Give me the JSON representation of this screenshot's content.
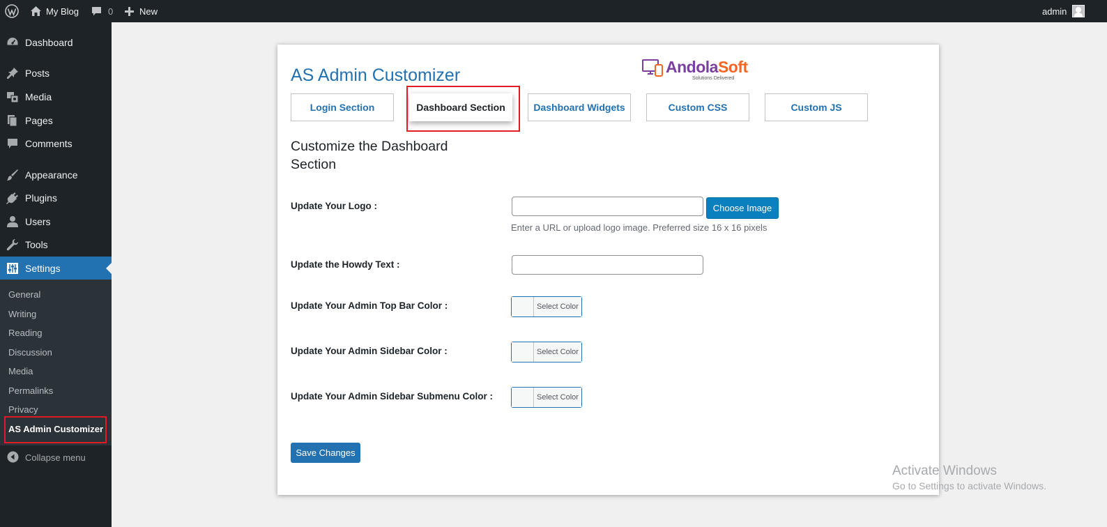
{
  "admin_bar": {
    "site_name": "My Blog",
    "comments_count": "0",
    "new_label": "New",
    "user_name": "admin",
    "icons": [
      "wordpress-icon",
      "home-icon",
      "comment-icon",
      "plus-icon"
    ]
  },
  "sidebar": {
    "items": [
      {
        "label": "Dashboard",
        "icon": "dashboard-icon"
      },
      {
        "label": "Posts",
        "icon": "pin-icon"
      },
      {
        "label": "Media",
        "icon": "media-icon"
      },
      {
        "label": "Pages",
        "icon": "pages-icon"
      },
      {
        "label": "Comments",
        "icon": "comment-icon"
      },
      {
        "label": "Appearance",
        "icon": "brush-icon"
      },
      {
        "label": "Plugins",
        "icon": "plug-icon"
      },
      {
        "label": "Users",
        "icon": "user-icon"
      },
      {
        "label": "Tools",
        "icon": "wrench-icon"
      },
      {
        "label": "Settings",
        "icon": "settings-icon"
      }
    ],
    "submenu": [
      "General",
      "Writing",
      "Reading",
      "Discussion",
      "Media",
      "Permalinks",
      "Privacy",
      "AS Admin Customizer"
    ],
    "collapse_label": "Collapse menu"
  },
  "main": {
    "title": "AS Admin Customizer",
    "logo": {
      "brand_a": "Andola",
      "brand_b": "Soft",
      "tagline": "Solutions Delivered"
    },
    "tabs": [
      "Login Section",
      "Dashboard Section",
      "Dashboard Widgets",
      "Custom CSS",
      "Custom JS"
    ],
    "active_tab": "Dashboard Section",
    "section_title": "Customize the Dashboard Section",
    "fields": {
      "logo": {
        "label": "Update Your Logo :",
        "value": "",
        "button": "Choose Image",
        "help": "Enter a URL or upload logo image. Preferred size 16 x 16 pixels"
      },
      "howdy": {
        "label": "Update the Howdy Text :",
        "value": ""
      },
      "topbar_color": {
        "label": "Update Your Admin Top Bar Color :",
        "button": "Select Color"
      },
      "sidebar_color": {
        "label": "Update Your Admin Sidebar Color :",
        "button": "Select Color"
      },
      "submenu_color": {
        "label": "Update Your Admin Sidebar Submenu Color :",
        "button": "Select Color"
      }
    },
    "save_label": "Save Changes"
  },
  "watermark": {
    "title": "Activate Windows",
    "subtitle": "Go to Settings to activate Windows."
  },
  "colors": {
    "accent": "#2271b1",
    "sidebar_bg": "#1d2327",
    "highlight": "#e01b24",
    "brand_purple": "#7b3fa0",
    "brand_orange": "#f26522"
  }
}
